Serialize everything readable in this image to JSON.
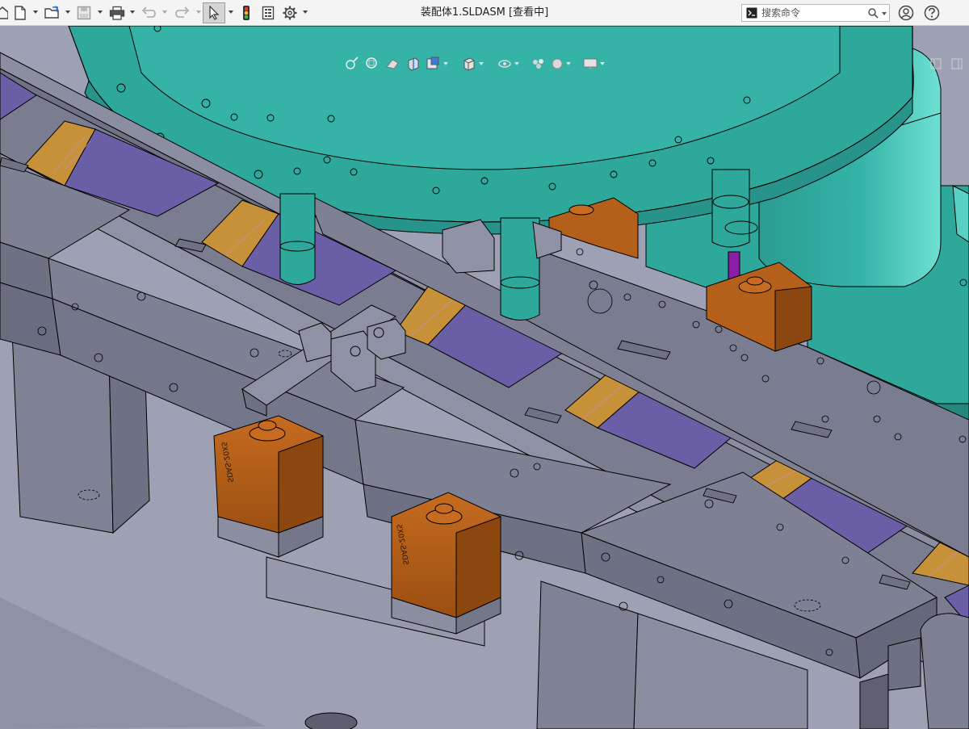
{
  "window": {
    "title": "装配体1.SLDASM [查看中]"
  },
  "search": {
    "placeholder": "搜索命令"
  },
  "toolbar": {
    "buttons": [
      "home-icon",
      "new-document-icon",
      "open-folder-icon",
      "save-icon",
      "print-icon",
      "undo-icon",
      "redo-icon",
      "select-pointer-icon",
      "traffic-light-icon",
      "properties-icon",
      "gear-icon"
    ]
  },
  "viewport": {
    "cylinder_label_1": "SDAS-20X5",
    "cylinder_label_2": "SDAS-20X5",
    "colors": {
      "teal": "#2fa89c",
      "purple": "#6a5fa6",
      "orange": "#b5601a",
      "gray": "#7c7e90",
      "background": "#9ea0b4"
    }
  }
}
